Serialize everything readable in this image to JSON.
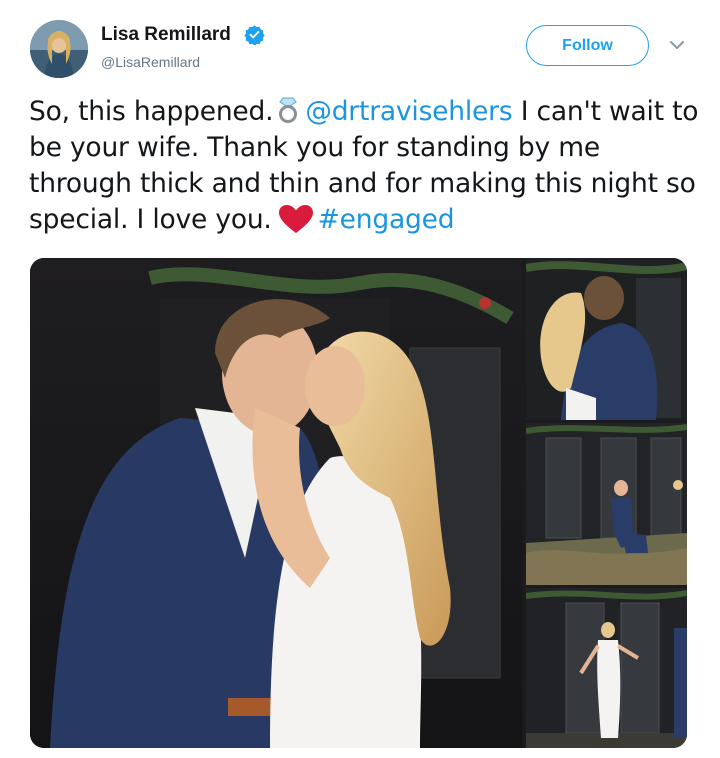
{
  "user": {
    "name": "Lisa Remillard",
    "handle": "@LisaRemillard",
    "verified": true
  },
  "follow_button": {
    "label": "Follow"
  },
  "colors": {
    "accent": "#1da1f2",
    "link": "#1b95e0",
    "heart": "#e0245e"
  },
  "tweet": {
    "segments": {
      "s1": "So, this happened.",
      "mention": "@drtravisehlers",
      "s2": "I can't wait to be your wife. Thank you for standing by me through thick and thin and for making this night so special. I love you.",
      "hashtag": "#engaged"
    },
    "icons": [
      "ring-icon",
      "heart-icon"
    ]
  },
  "media": {
    "photos": [
      {
        "name": "couple-kissing-photo"
      },
      {
        "name": "couple-hugging-photo"
      },
      {
        "name": "proposal-kneeling-photo"
      },
      {
        "name": "woman-celebrating-photo"
      }
    ]
  }
}
